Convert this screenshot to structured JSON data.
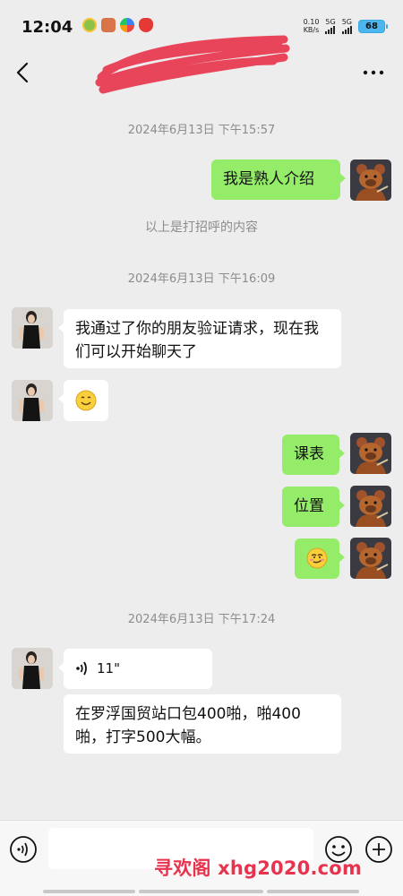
{
  "status_bar": {
    "time": "12:04",
    "net_speed_value": "0.10",
    "net_speed_unit": "KB/s",
    "sim1_label": "5G",
    "sim2_label": "5G",
    "battery": "68"
  },
  "header": {
    "title": "",
    "title_redacted": true
  },
  "messages": {
    "ts1": "2024年6月13日 下午15:57",
    "out_intro": "我是熟人介绍",
    "system_note": "以上是打招呼的内容",
    "ts2": "2024年6月13日 下午16:09",
    "in_verify": "我通过了你的朋友验证请求，现在我们可以开始聊天了",
    "out_schedule": "课表",
    "out_location": "位置",
    "ts3": "2024年6月13日 下午17:24",
    "voice_duration": "11\"",
    "in_text": "在罗浮国贸站口包400啪，啪400啪，打字500大幅。"
  },
  "input": {
    "placeholder": ""
  },
  "watermark": "寻欢阁 xhg2020.com",
  "colors": {
    "background": "#ededed",
    "outgoing_bubble": "#95ec69",
    "incoming_bubble": "#ffffff",
    "timestamp": "#8c8c8c",
    "watermark": "#e8334f",
    "redaction": "#e8384f"
  },
  "icons": {
    "back": "chevron-left-icon",
    "more": "more-dots-icon",
    "voice_input": "voice-input-icon",
    "emoji": "emoji-icon",
    "plus": "plus-circle-icon",
    "voice_wave": "voice-wave-icon"
  }
}
